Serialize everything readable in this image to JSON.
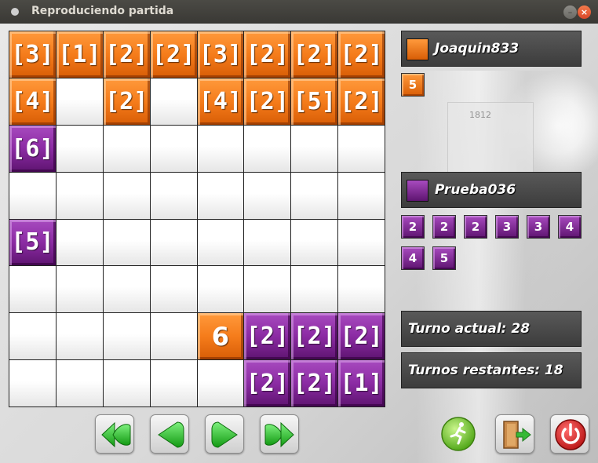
{
  "window": {
    "title": "Reproduciendo partida"
  },
  "board": {
    "rows": [
      [
        {
          "owner": "orange",
          "label": "[3]"
        },
        {
          "owner": "orange",
          "label": "[1]"
        },
        {
          "owner": "orange",
          "label": "[2]"
        },
        {
          "owner": "orange",
          "label": "[2]"
        },
        {
          "owner": "orange",
          "label": "[3]"
        },
        {
          "owner": "orange",
          "label": "[2]"
        },
        {
          "owner": "orange",
          "label": "[2]"
        },
        {
          "owner": "orange",
          "label": "[2]"
        }
      ],
      [
        {
          "owner": "orange",
          "label": "[4]"
        },
        null,
        {
          "owner": "orange",
          "label": "[2]"
        },
        null,
        {
          "owner": "orange",
          "label": "[4]"
        },
        {
          "owner": "orange",
          "label": "[2]"
        },
        {
          "owner": "orange",
          "label": "[5]"
        },
        {
          "owner": "orange",
          "label": "[2]"
        }
      ],
      [
        {
          "owner": "purple",
          "label": "[6]"
        },
        null,
        null,
        null,
        null,
        null,
        null,
        null
      ],
      [
        null,
        null,
        null,
        null,
        null,
        null,
        null,
        null
      ],
      [
        {
          "owner": "purple",
          "label": "[5]"
        },
        null,
        null,
        null,
        null,
        null,
        null,
        null
      ],
      [
        null,
        null,
        null,
        null,
        null,
        null,
        null,
        null
      ],
      [
        null,
        null,
        null,
        null,
        {
          "owner": "orange",
          "label": "6",
          "single": true
        },
        {
          "owner": "purple",
          "label": "[2]"
        },
        {
          "owner": "purple",
          "label": "[2]"
        },
        {
          "owner": "purple",
          "label": "[2]"
        }
      ],
      [
        null,
        null,
        null,
        null,
        null,
        {
          "owner": "purple",
          "label": "[2]"
        },
        {
          "owner": "purple",
          "label": "[2]"
        },
        {
          "owner": "purple",
          "label": "[1]"
        }
      ]
    ]
  },
  "players": [
    {
      "name": "Joaquin833",
      "color": "orange",
      "hand": [
        "5"
      ]
    },
    {
      "name": "Prueba036",
      "color": "purple",
      "hand": [
        "2",
        "2",
        "2",
        "3",
        "3",
        "4",
        "4",
        "5"
      ]
    }
  ],
  "status": {
    "turno_actual": "Turno actual: 28",
    "turnos_restantes": "Turnos restantes: 18"
  },
  "controls": {
    "first_icon": "double-left-arrow-icon",
    "prev_icon": "left-arrow-icon",
    "next_icon": "right-arrow-icon",
    "last_icon": "double-right-arrow-icon",
    "play_icon": "running-man-icon",
    "exit_icon": "exit-door-icon",
    "power_icon": "power-icon"
  },
  "colors": {
    "orange": "#f57c1b",
    "purple": "#8b2ba3",
    "panel": "#4a4a4a",
    "arrow_green": "#2ec02e",
    "power_red": "#d81b1b"
  }
}
